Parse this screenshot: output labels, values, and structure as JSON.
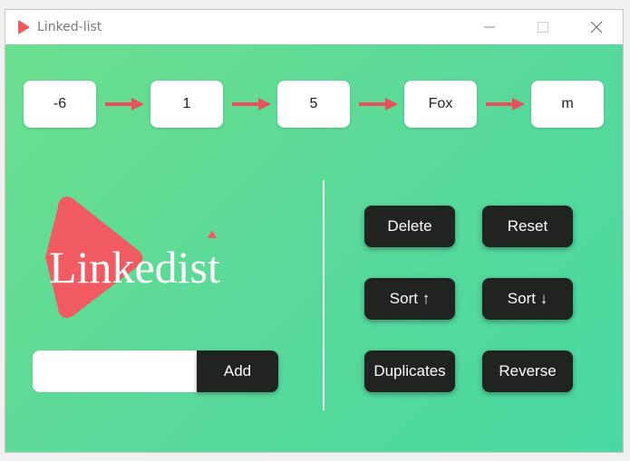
{
  "window": {
    "title": "Linked-list",
    "icon": "play-triangle-icon",
    "controls": [
      "minimize-icon",
      "maximize-icon",
      "close-icon"
    ]
  },
  "list": {
    "nodes": [
      "-6",
      "1",
      "5",
      "Fox",
      "m"
    ],
    "arrow_color": "#e9505a"
  },
  "logo": {
    "text_part1": "Link",
    "text_part2": "edist",
    "triangle_color": "#f05a60"
  },
  "add": {
    "input_value": "",
    "button_label": "Add"
  },
  "actions": {
    "delete": "Delete",
    "reset": "Reset",
    "sort_asc": "Sort ↑",
    "sort_desc": "Sort ↓",
    "duplicates": "Duplicates",
    "reverse": "Reverse"
  },
  "colors": {
    "gradient_start": "#6bdf8e",
    "gradient_end": "#48d9a2",
    "button_bg": "#20231f",
    "accent": "#f05a60"
  }
}
